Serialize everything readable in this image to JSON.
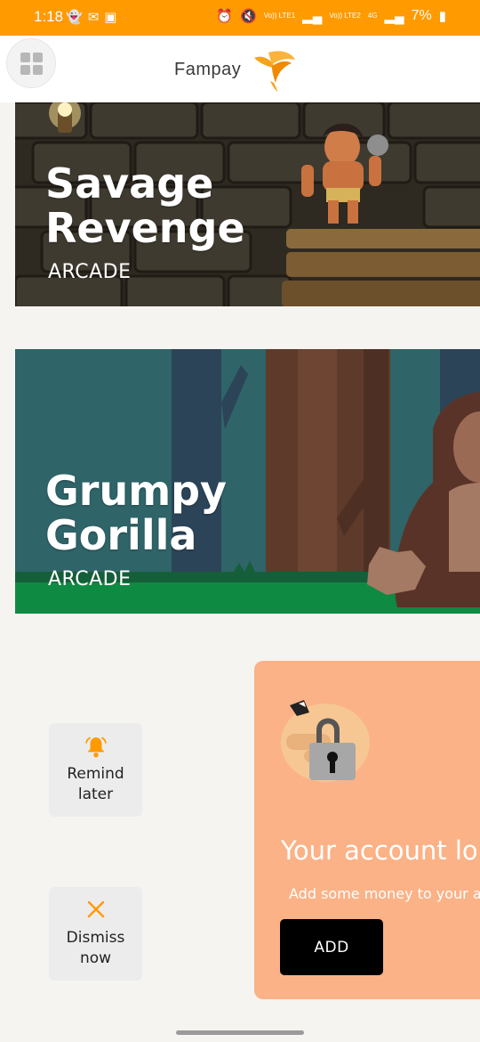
{
  "status_bar": {
    "time": "1:18",
    "left_icons": [
      "snapchat-icon",
      "gmail-icon",
      "gallery-icon"
    ],
    "sim1_label": "Vo)) LTE1",
    "sim2_label": "Vo)) LTE2",
    "network_label": "4G",
    "battery": "7%",
    "bg_color": "#ff9a00"
  },
  "app_bar": {
    "brand": "Fampay",
    "logo_color": "#f7a21b"
  },
  "games": [
    {
      "title_line1": "Savage",
      "title_line2": "Revenge",
      "category": "ARCADE"
    },
    {
      "title_line1": "Grumpy",
      "title_line2": "Gorilla",
      "category": "ARCADE"
    }
  ],
  "actions": {
    "remind": {
      "line1": "Remind",
      "line2": "later",
      "icon": "bell-icon"
    },
    "dismiss": {
      "line1": "Dismiss",
      "line2": "now",
      "icon": "close-icon"
    }
  },
  "lock_card": {
    "title": "Your account lo",
    "subtitle": "Add some money to your a",
    "button_label": "ADD",
    "bg_color": "#fbb287"
  }
}
